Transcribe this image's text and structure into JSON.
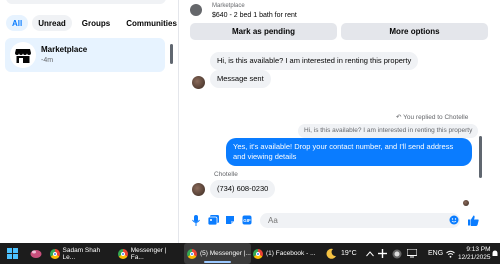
{
  "filters": [
    "All",
    "Unread",
    "Groups",
    "Communities"
  ],
  "conversation": {
    "title": "Marketplace",
    "time": "-4m"
  },
  "listing": {
    "subtitle": "Marketplace",
    "title": "$640 - 2 bed 1 bath for rent"
  },
  "actions": {
    "pending": "Mark as pending",
    "more": "More options"
  },
  "messages": {
    "m1": "Hi, is this available? I am interested in renting this property",
    "m2": "Message sent",
    "replied_label": "You replied to Chotelle",
    "quoted": "Hi, is this available? I am interested in renting this property",
    "reply": "Yes, it's available! Drop your contact number, and I'll send address and viewing details",
    "sender": "Chotelle",
    "phone": "(734) 608-0230"
  },
  "composer": {
    "placeholder": "Aa"
  },
  "taskbar": {
    "task1": "Sadam Shah Le...",
    "task2": "Messenger | Fa...",
    "task3": "(5) Messenger |...",
    "task4": "(1) Facebook - ...",
    "temp": "19°C",
    "lang": "ENG",
    "time": "9:13 PM",
    "date": "12/21/2025"
  },
  "colors": {
    "accent": "#0a7cff",
    "bubble_gray": "#f0f2f5",
    "taskbar": "#1c1c1c"
  }
}
